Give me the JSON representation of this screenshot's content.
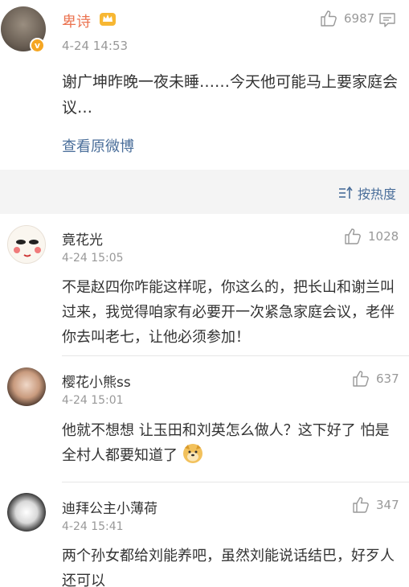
{
  "post": {
    "author": "卑诗",
    "time": "4-24  14:53",
    "likes": "6987",
    "text": "谢广坤昨晚一夜未睡……今天他可能马上要家庭会议…",
    "view_original": "查看原微博"
  },
  "sort": {
    "label": "按热度"
  },
  "comments": [
    {
      "name": "竟花光",
      "time": "4-24  15:05",
      "likes": "1028",
      "text": "不是赵四你咋能这样呢，你这么的，把长山和谢兰叫过来，我觉得咱家有必要开一次紧急家庭会议，老伴你去叫老七，让他必须参加！"
    },
    {
      "name": "樱花小熊ss",
      "time": "4-24  15:01",
      "likes": "637",
      "text": "他就不想想 让玉田和刘英怎么做人？这下好了 怕是全村人都要知道了"
    },
    {
      "name": "迪拜公主小薄荷",
      "time": "4-24  15:41",
      "likes": "347",
      "text": "两个孙女都给刘能养吧，虽然刘能说话结巴，好歹人还可以"
    }
  ],
  "colors": {
    "author_name": "#eb7350",
    "link": "#4a6e9a",
    "muted": "#999999",
    "verified_badge": "#f5a623"
  },
  "icons": [
    "like-icon",
    "comment-icon",
    "crown-icon",
    "verified-badge",
    "sort-icon",
    "doge-emoji"
  ]
}
